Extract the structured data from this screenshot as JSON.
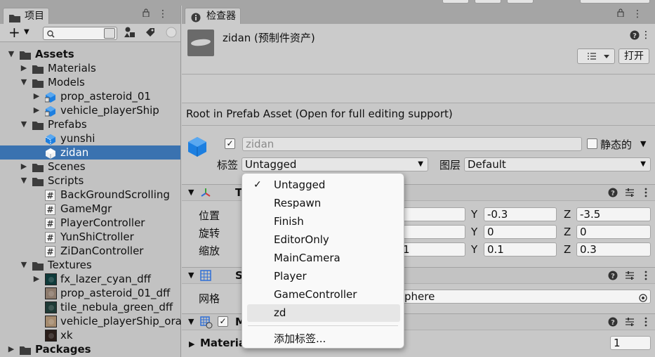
{
  "project_panel": {
    "tab_label": "项目",
    "search_placeholder": "",
    "tree": [
      {
        "label": "Assets",
        "depth": 0,
        "expanded": true,
        "bold": true,
        "icon": "folder-icon"
      },
      {
        "label": "Materials",
        "depth": 1,
        "expanded": false,
        "icon": "folder-icon"
      },
      {
        "label": "Models",
        "depth": 1,
        "expanded": true,
        "icon": "folder-icon"
      },
      {
        "label": "prop_asteroid_01",
        "depth": 2,
        "expanded": false,
        "icon": "model-prefab-icon"
      },
      {
        "label": "vehicle_playerShip",
        "depth": 2,
        "expanded": false,
        "icon": "model-prefab-icon"
      },
      {
        "label": "Prefabs",
        "depth": 1,
        "expanded": true,
        "icon": "folder-icon"
      },
      {
        "label": "yunshi",
        "depth": 2,
        "icon": "prefab-icon"
      },
      {
        "label": "zidan",
        "depth": 2,
        "icon": "prefab-icon",
        "selected": true
      },
      {
        "label": "Scenes",
        "depth": 1,
        "expanded": false,
        "icon": "folder-icon"
      },
      {
        "label": "Scripts",
        "depth": 1,
        "expanded": true,
        "icon": "folder-icon"
      },
      {
        "label": "BackGroundScrolling",
        "depth": 2,
        "icon": "script-icon"
      },
      {
        "label": "GameMgr",
        "depth": 2,
        "icon": "script-icon"
      },
      {
        "label": "PlayerController",
        "depth": 2,
        "icon": "script-icon"
      },
      {
        "label": "YunShiCtroller",
        "depth": 2,
        "icon": "script-icon"
      },
      {
        "label": "ZiDanController",
        "depth": 2,
        "icon": "script-icon"
      },
      {
        "label": "Textures",
        "depth": 1,
        "expanded": true,
        "icon": "folder-icon"
      },
      {
        "label": "fx_lazer_cyan_dff",
        "depth": 2,
        "expanded": false,
        "icon": "texture-thumb",
        "thumb": "#0e3a3a"
      },
      {
        "label": "prop_asteroid_01_dff",
        "depth": 2,
        "icon": "texture-thumb",
        "thumb": "#8c7a6c"
      },
      {
        "label": "tile_nebula_green_dff",
        "depth": 2,
        "icon": "texture-thumb",
        "thumb": "#1e3a36"
      },
      {
        "label": "vehicle_playerShip_oran",
        "depth": 2,
        "icon": "texture-thumb",
        "thumb": "#a48a6e"
      },
      {
        "label": "xk",
        "depth": 2,
        "icon": "texture-thumb",
        "thumb": "#2a1e1a"
      },
      {
        "label": "Packages",
        "depth": 0,
        "expanded": false,
        "bold": true,
        "icon": "folder-icon"
      }
    ]
  },
  "inspector": {
    "tab_label": "检查器",
    "asset_title": "zidan (预制件资产)",
    "open_button": "打开",
    "root_message": "Root in Prefab Asset (Open for full editing support)",
    "object_name": "zidan",
    "static_label": "静态的",
    "tag_label": "标签",
    "tag_value": "Untagged",
    "layer_label": "图层",
    "layer_value": "Default",
    "transform": {
      "title": "T",
      "position_label": "位置",
      "rotation_label": "旋转",
      "scale_label": "缩放",
      "y_axis": "Y",
      "z_axis": "Z",
      "position": {
        "y": "-0.3",
        "z": "-3.5"
      },
      "rotation": {
        "y": "0",
        "z": "0"
      },
      "scale": {
        "x": "1",
        "y": "0.1",
        "z": "0.3"
      }
    },
    "mesh_filter": {
      "title": "S",
      "mesh_label": "网格",
      "mesh_value": "phere"
    },
    "mesh_renderer": {
      "title": "M",
      "materials_label": "Materia",
      "materials_count": "1"
    }
  },
  "tag_dropdown": {
    "options": [
      "Untagged",
      "Respawn",
      "Finish",
      "EditorOnly",
      "MainCamera",
      "Player",
      "GameController",
      "zd"
    ],
    "checked": "Untagged",
    "hovered": "zd",
    "add_tag": "添加标签..."
  },
  "colors": {
    "selection": "#3a72b0",
    "transform_x": "#d23b3b",
    "transform_y": "#3aa33a",
    "transform_z": "#2f6fd6",
    "prefab_blue": "#1d7fe0"
  }
}
